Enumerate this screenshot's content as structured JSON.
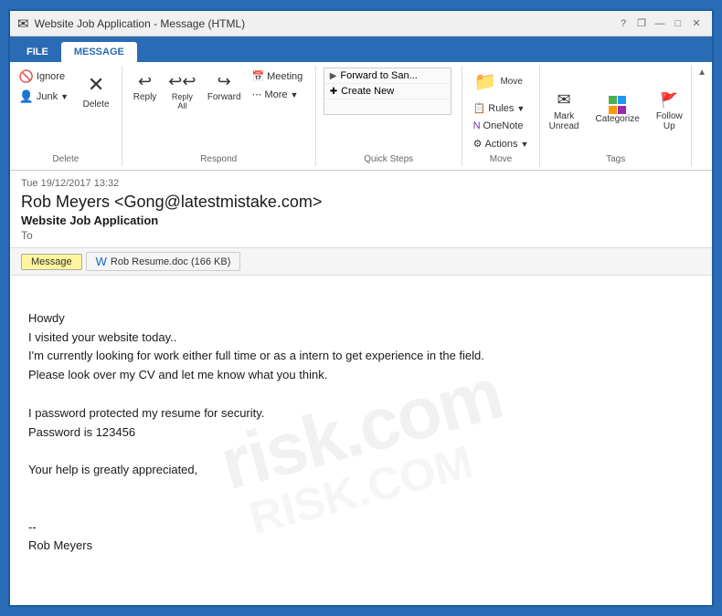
{
  "window": {
    "title": "Website Job Application - Message (HTML)",
    "help_icon": "?",
    "restore_icon": "❐",
    "minimize_icon": "—",
    "maximize_icon": "□",
    "close_icon": "✕"
  },
  "tabs": {
    "file_label": "FILE",
    "message_label": "MESSAGE"
  },
  "ribbon": {
    "delete_group_label": "Delete",
    "respond_group_label": "Respond",
    "quick_steps_group_label": "Quick Steps",
    "move_group_label": "Move",
    "tags_group_label": "Tags",
    "ignore_btn": "Ignore",
    "junk_btn": "Junk",
    "delete_btn": "Delete",
    "reply_btn": "Reply",
    "reply_all_btn": "Reply All",
    "forward_btn": "Forward",
    "meeting_btn": "Meeting",
    "more_btn": "More",
    "forward_to_san": "Forward to San...",
    "create_new": "Create New",
    "move_btn": "Move",
    "rules_btn": "Rules",
    "onenote_btn": "OneNote",
    "actions_btn": "Actions",
    "mark_unread_btn": "Mark\nUnread",
    "categorize_btn": "Categorize",
    "follow_up_btn": "Follow\nUp"
  },
  "email": {
    "date": "Tue 19/12/2017 13:32",
    "from": "Rob Meyers <Gong@latestmistake.com>",
    "subject": "Website Job Application",
    "to_label": "To",
    "tab_message": "Message",
    "tab_attachment": "Rob Resume.doc (166 KB)",
    "body_lines": [
      "",
      "Howdy",
      "I visited your website today..",
      "I'm currently looking for work either full time or as a intern to get experience in the field.",
      "Please look over my CV and let me know what you think.",
      "",
      "I password protected my resume for security.",
      "Password is 123456",
      "",
      "Your help is greatly appreciated,",
      "",
      "",
      "--",
      "Rob Meyers"
    ]
  },
  "watermark": {
    "line1": "risk.com",
    "line2": "RISK.COM"
  }
}
